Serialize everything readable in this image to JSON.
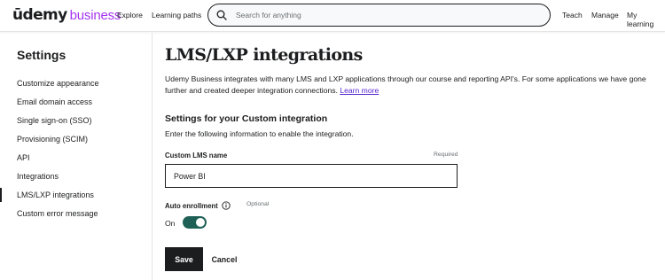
{
  "header": {
    "logo_udemy": "ūdemy",
    "logo_business": "business",
    "nav_explore": "Explore",
    "nav_learning_paths": "Learning paths",
    "search_placeholder": "Search for anything",
    "nav_teach": "Teach",
    "nav_manage": "Manage",
    "nav_my_learning": "My learning"
  },
  "sidebar": {
    "title": "Settings",
    "active_index": 6,
    "items": [
      {
        "label": "Customize appearance"
      },
      {
        "label": "Email domain access"
      },
      {
        "label": "Single sign-on (SSO)"
      },
      {
        "label": "Provisioning (SCIM)"
      },
      {
        "label": "API"
      },
      {
        "label": "Integrations"
      },
      {
        "label": "LMS/LXP integrations"
      },
      {
        "label": "Custom error message"
      }
    ]
  },
  "main": {
    "title": "LMS/LXP integrations",
    "intro_text": "Udemy Business integrates with many LMS and LXP applications through our course and reporting API's. For some applications we have gone further and created deeper integration connections. ",
    "learn_more": "Learn more",
    "section_title": "Settings for your Custom integration",
    "section_description": "Enter the following information to enable the integration.",
    "lms_name_label": "Custom LMS name",
    "lms_name_required": "Required",
    "lms_name_value": "Power BI",
    "auto_enrollment_label": "Auto enrollment",
    "auto_enrollment_optional": "Optional",
    "auto_enrollment_state": "On",
    "auto_enrollment_enabled": true,
    "save_label": "Save",
    "cancel_label": "Cancel"
  },
  "colors": {
    "brand_purple": "#a435f0",
    "link_purple": "#5624d0",
    "toggle_green": "#1e6055",
    "text_dark": "#1c1d1f"
  }
}
